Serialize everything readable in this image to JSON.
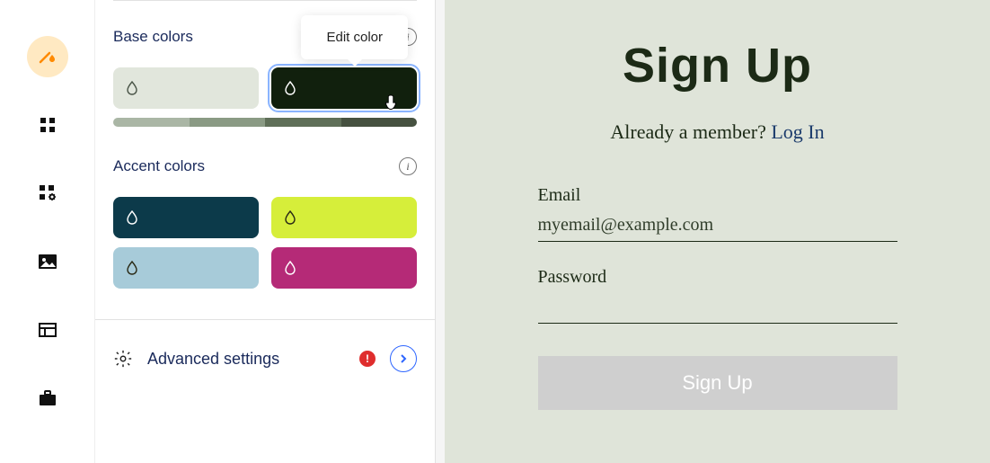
{
  "rail": {
    "items": [
      "theme",
      "grid",
      "widgets",
      "image",
      "table",
      "briefcase"
    ]
  },
  "tooltip": {
    "label": "Edit color"
  },
  "base": {
    "title": "Base colors",
    "swatches": [
      {
        "color": "#e1e6dc",
        "icon": "dark"
      },
      {
        "color": "#11200d",
        "icon": "light",
        "selected": true
      }
    ],
    "gradient": [
      "#aab6a5",
      "#8a9a84",
      "#5f6f58",
      "#465140"
    ]
  },
  "accent": {
    "title": "Accent colors",
    "swatches": [
      {
        "color": "#0c3a4a",
        "icon": "light"
      },
      {
        "color": "#d6ee3a",
        "icon": "dark"
      },
      {
        "color": "#a7cbd9",
        "icon": "dark"
      },
      {
        "color": "#b52a77",
        "icon": "light"
      }
    ]
  },
  "advanced": {
    "label": "Advanced settings"
  },
  "preview": {
    "heading": "Sign Up",
    "member_prefix": "Already a member? ",
    "login_text": "Log In",
    "email_label": "Email",
    "email_placeholder": "myemail@example.com",
    "password_label": "Password",
    "button_label": "Sign Up"
  }
}
